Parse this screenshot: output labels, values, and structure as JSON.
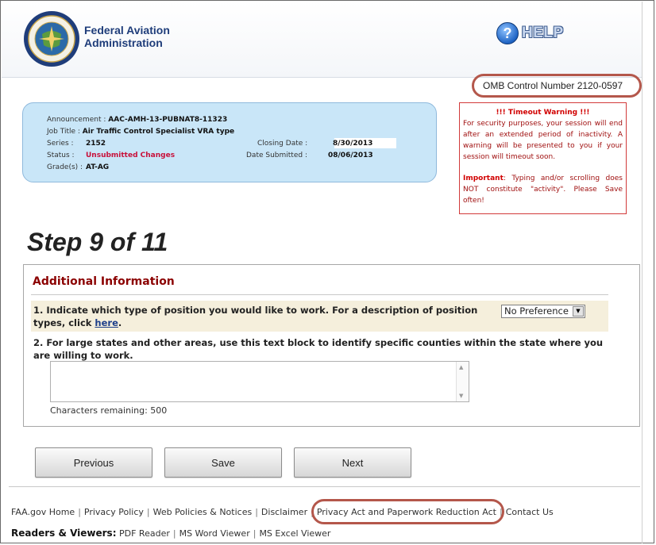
{
  "header": {
    "agency_line1": "Federal Aviation",
    "agency_line2": "Administration",
    "help_label": "HELP",
    "help_glyph": "?"
  },
  "omb": "OMB Control Number 2120-0597",
  "job": {
    "announcement_label": "Announcement :",
    "announcement": "AAC-AMH-13-PUBNAT8-11323",
    "title_label": "Job Title :",
    "title": "Air Traffic Control Specialist VRA type",
    "series_label": "Series :",
    "series": "2152",
    "status_label": "Status :",
    "status": "Unsubmitted Changes",
    "grade_label": "Grade(s) :",
    "grade": "AT-AG",
    "closing_label": "Closing Date :",
    "closing": "8/30/2013",
    "submitted_label": "Date Submitted :",
    "submitted": "08/06/2013"
  },
  "timeout": {
    "title": "!!! Timeout Warning !!!",
    "body": "For security purposes, your session will end after an extended period of inactivity. A warning will be presented to you if your session will timeout soon.",
    "important_label": "Important",
    "important_body": ": Typing and/or scrolling does NOT constitute \"activity\". Please Save often!"
  },
  "step": "Step 9 of 11",
  "section": {
    "title": "Additional Information",
    "q1_text": "1. Indicate which type of position you would like to work. For a description of position types, click ",
    "q1_link": "here",
    "q1_end": ".",
    "q1_select_value": "No Preference",
    "q2_text": "2. For large states and other areas, use this text block to identify specific counties within the state where you are willing to work.",
    "chars_remaining": "Characters remaining: 500"
  },
  "buttons": {
    "previous": "Previous",
    "save": "Save",
    "next": "Next"
  },
  "footer": {
    "links": [
      "FAA.gov Home",
      "Privacy Policy",
      "Web Policies & Notices",
      "Disclaimer",
      "Privacy Act and Paperwork Reduction Act",
      "Contact Us"
    ],
    "readers_label": "Readers & Viewers:",
    "readers": [
      "PDF Reader",
      "MS Word Viewer",
      "MS Excel Viewer"
    ]
  },
  "colors": {
    "accent_blue": "#1f3d7a",
    "job_box": "#c9e6f8",
    "alert_red": "#d10000",
    "section_title": "#8b0000",
    "annotation_ring": "#b4574b"
  }
}
